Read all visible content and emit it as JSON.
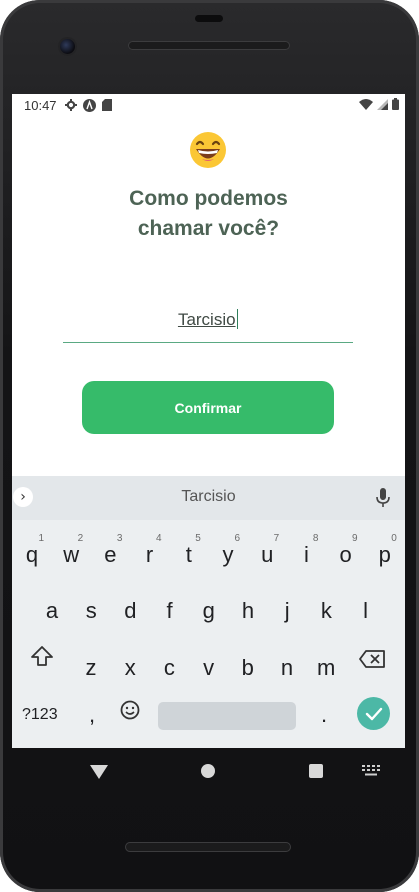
{
  "status_bar": {
    "time": "10:47",
    "left_icons": [
      "settings-icon",
      "a-circle-icon",
      "sd-card-icon"
    ],
    "right_icons": [
      "wifi-icon",
      "signal-icon",
      "battery-icon"
    ]
  },
  "prompt": {
    "emoji": "grinning-face-icon",
    "title_line1": "Como podemos",
    "title_line2": "chamar você?"
  },
  "name_input": {
    "value": "Tarcisio"
  },
  "confirm_button": {
    "label": "Confirmar",
    "color": "#36bb6a"
  },
  "keyboard": {
    "suggestion": "Tarcisio",
    "row1": [
      "q",
      "w",
      "e",
      "r",
      "t",
      "y",
      "u",
      "i",
      "o",
      "p"
    ],
    "row1_hints": [
      "1",
      "2",
      "3",
      "4",
      "5",
      "6",
      "7",
      "8",
      "9",
      "0"
    ],
    "row2": [
      "a",
      "s",
      "d",
      "f",
      "g",
      "h",
      "j",
      "k",
      "l"
    ],
    "row3": [
      "z",
      "x",
      "c",
      "v",
      "b",
      "n",
      "m"
    ],
    "symbols_label": "?123",
    "comma": ",",
    "period": ".",
    "enter_color": "#4cb8a6"
  }
}
